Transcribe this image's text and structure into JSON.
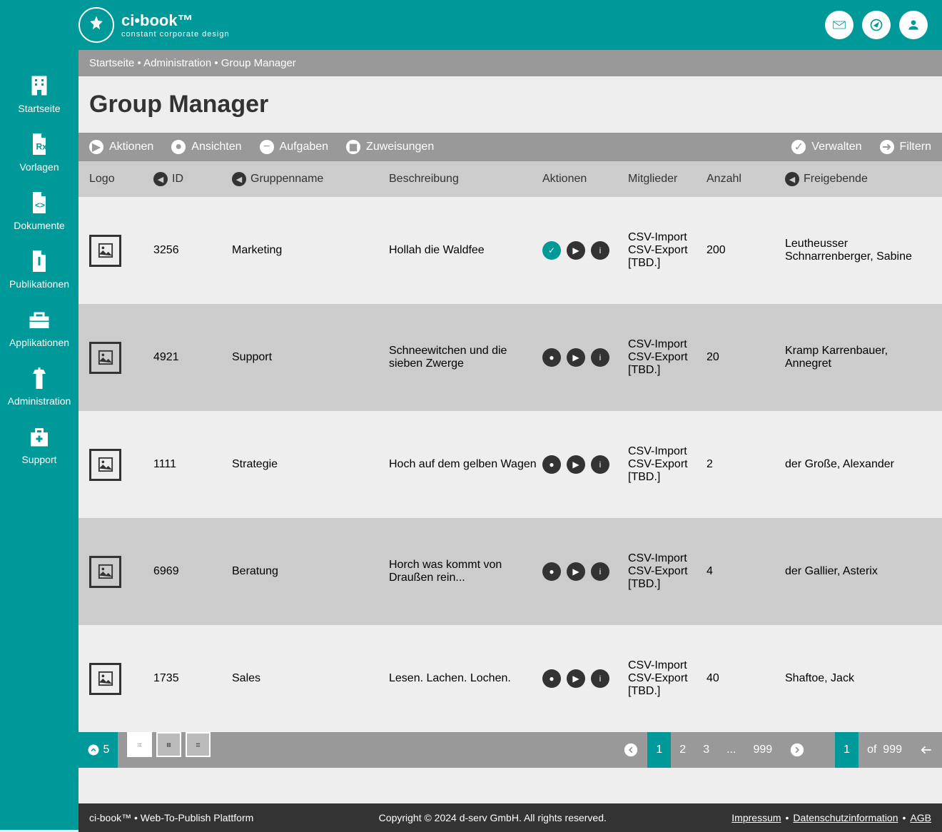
{
  "brand": {
    "title": "ci•book™",
    "subtitle": "constant corporate design"
  },
  "sidebar": {
    "items": [
      {
        "label": "Startseite"
      },
      {
        "label": "Vorlagen"
      },
      {
        "label": "Dokumente"
      },
      {
        "label": "Publikationen"
      },
      {
        "label": "Applikationen"
      },
      {
        "label": "Administration"
      },
      {
        "label": "Support"
      }
    ]
  },
  "breadcrumb": "Startseite • Administration • Group Manager",
  "page_title": "Group Manager",
  "toolbar": {
    "left": [
      {
        "label": "Aktionen"
      },
      {
        "label": "Ansichten"
      },
      {
        "label": "Aufgaben"
      },
      {
        "label": "Zuweisungen"
      }
    ],
    "right": [
      {
        "label": "Verwalten"
      },
      {
        "label": "Filtern"
      }
    ]
  },
  "columns": {
    "logo": "Logo",
    "id": "ID",
    "name": "Gruppenname",
    "desc": "Beschreibung",
    "actions": "Aktionen",
    "members": "Mitglieder",
    "count": "Anzahl",
    "approver": "Freigebende"
  },
  "members_lines": {
    "l1": "CSV-Import",
    "l2": "CSV-Export",
    "l3": "[TBD.]"
  },
  "rows": [
    {
      "id": "3256",
      "name": "Marketing",
      "desc": "Hollah die Waldfee",
      "count": "200",
      "approver": "Leutheusser Schnarrenberger, Sabine",
      "active": true
    },
    {
      "id": "4921",
      "name": "Support",
      "desc": "Schneewitchen und die sieben Zwerge",
      "count": "20",
      "approver": "Kramp Karrenbauer, Annegret",
      "active": false
    },
    {
      "id": "1111",
      "name": "Strategie",
      "desc": "Hoch auf dem gelben Wagen",
      "count": "2",
      "approver": "der Große, Alexander",
      "active": false
    },
    {
      "id": "6969",
      "name": "Beratung",
      "desc": "Horch was kommt von Draußen rein...",
      "count": "4",
      "approver": "der Gallier, Asterix",
      "active": false
    },
    {
      "id": "1735",
      "name": "Sales",
      "desc": "Lesen. Lachen. Lochen.",
      "count": "40",
      "approver": "Shaftoe, Jack",
      "active": false
    }
  ],
  "pagination": {
    "per_page": "5",
    "pages": [
      "1",
      "2",
      "3",
      "...",
      "999"
    ],
    "current": "1",
    "of": "of",
    "total": "999"
  },
  "footer": {
    "left": "ci-book™ • Web-To-Publish Plattform",
    "center": "Copyright © 2024 d-serv GmbH. All rights reserved.",
    "links": [
      "Impressum",
      "Datenschutzinformation",
      "AGB"
    ]
  }
}
